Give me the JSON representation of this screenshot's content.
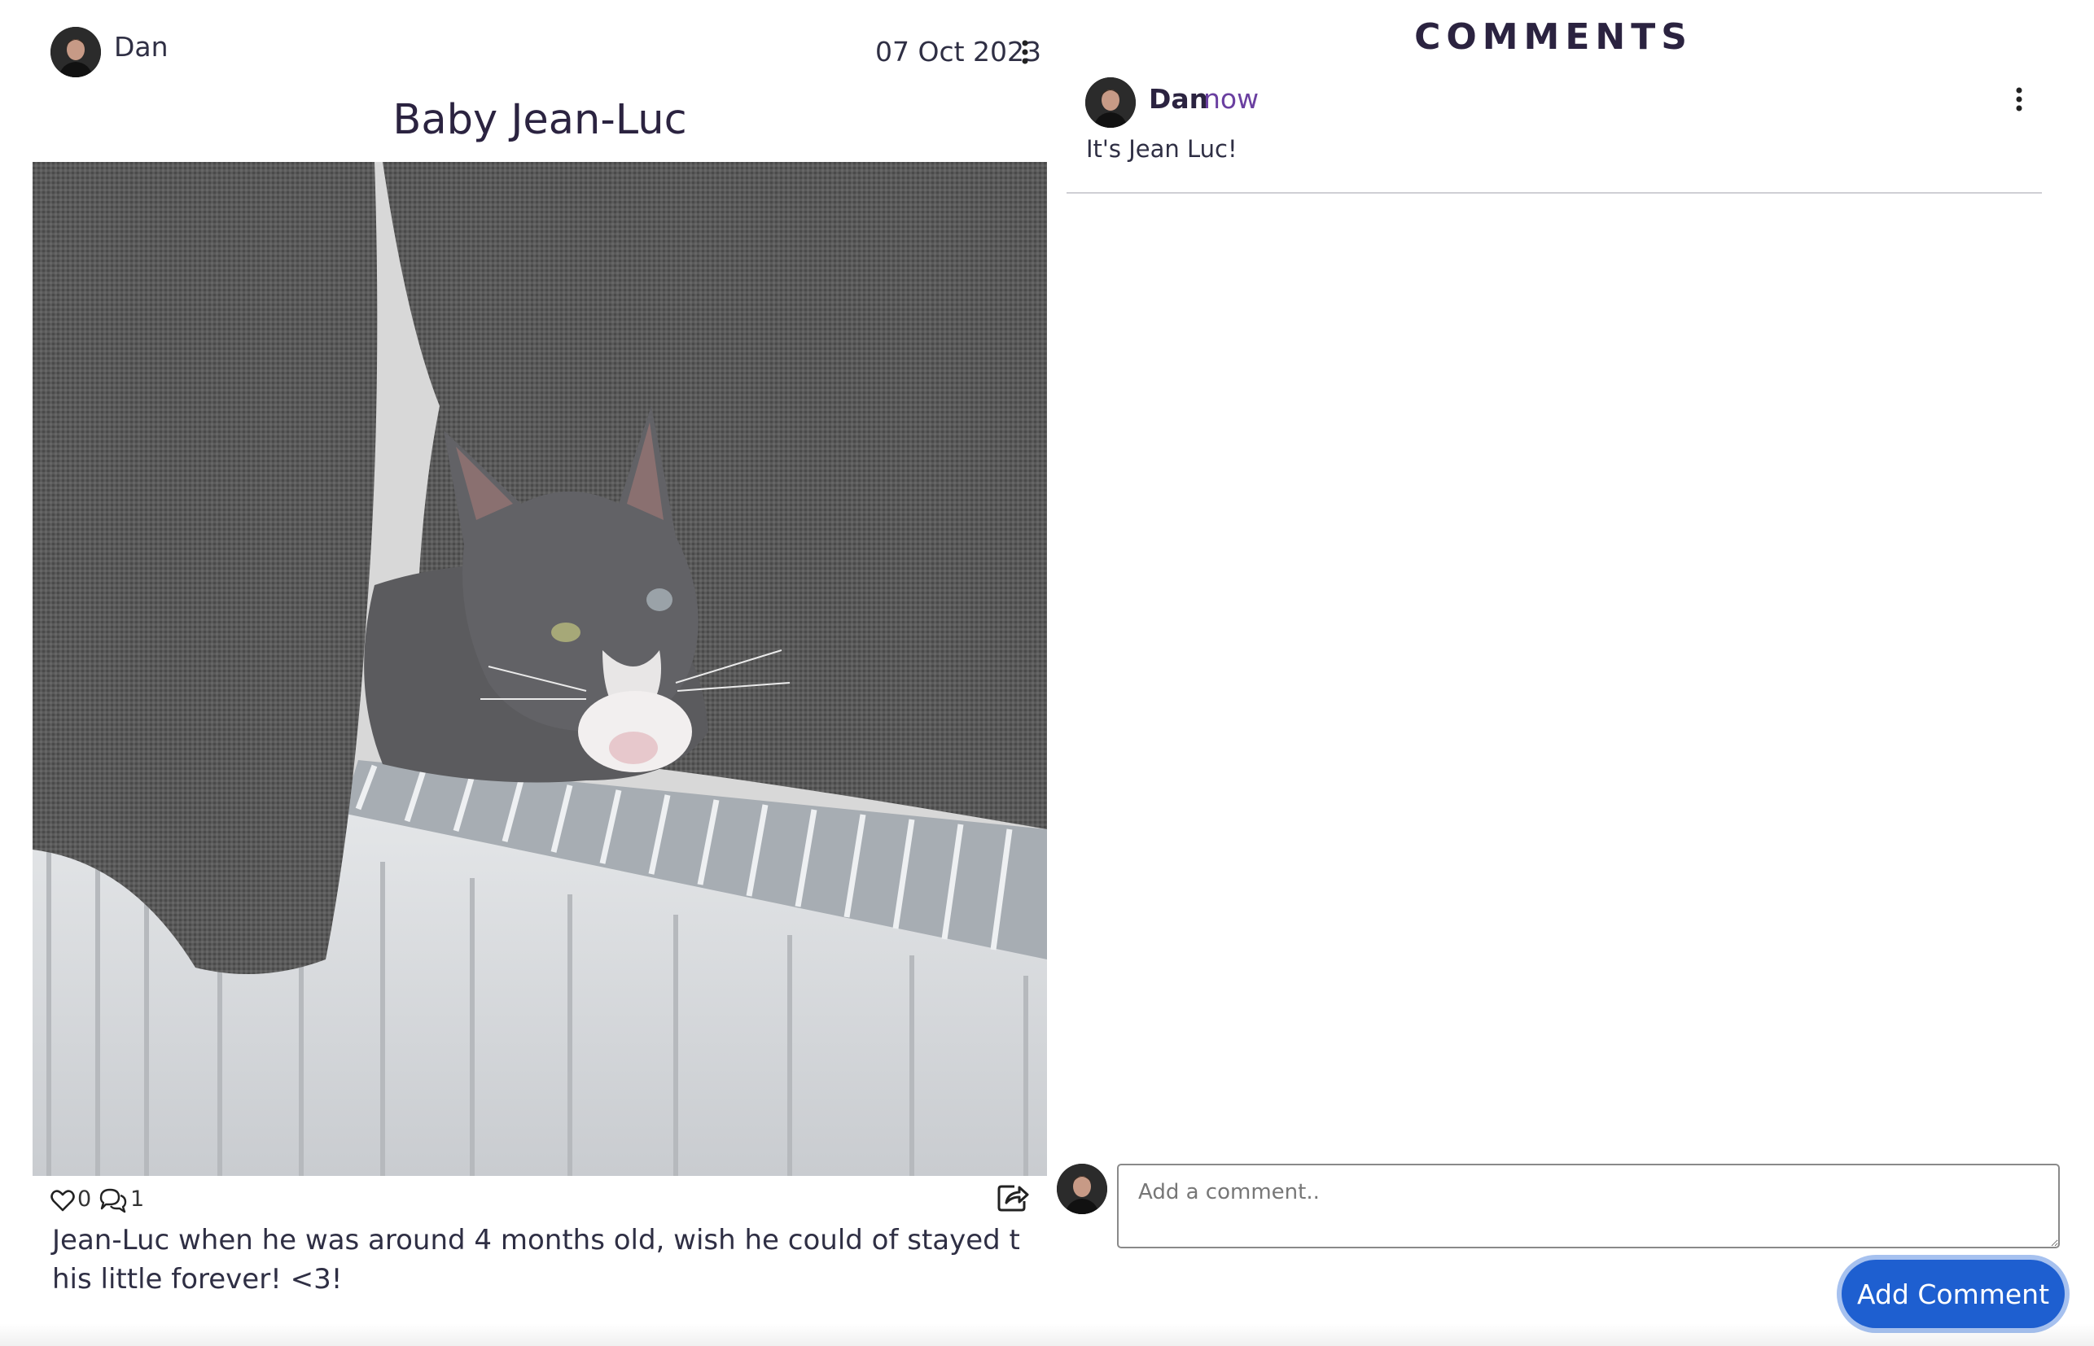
{
  "post": {
    "author": "Dan",
    "date": "07 Oct 2023",
    "title": "Baby Jean-Luc",
    "likes": "0",
    "comments_count": "1",
    "caption": "Jean-Luc when he was around 4 months old, wish he could of stayed this little forever! <3!",
    "icons": {
      "menu": "kebab-menu-icon",
      "like": "heart-icon",
      "comments": "speech-bubbles-icon",
      "share": "share-icon"
    }
  },
  "comments_panel": {
    "heading": "COMMENTS",
    "items": [
      {
        "author": "Dan",
        "time": "now",
        "text": "It's Jean Luc!"
      }
    ],
    "input": {
      "placeholder": "Add a comment..",
      "value": ""
    },
    "submit_label": "Add Comment"
  },
  "colors": {
    "accent_button": "#1e5fd0",
    "timestamp": "#6a3fa0",
    "heading_text": "#2b2340"
  }
}
